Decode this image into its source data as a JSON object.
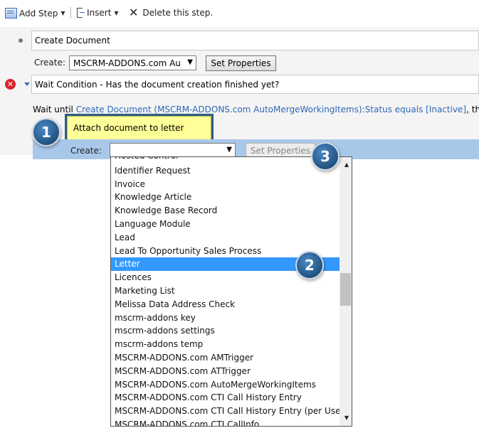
{
  "toolbar": {
    "add_step_label": "Add Step",
    "insert_label": "Insert",
    "delete_label": "Delete this step."
  },
  "step_create_document": {
    "title": "Create Document",
    "create_label": "Create:",
    "entity_value": "MSCRM-ADDONS.com Au",
    "set_properties_label": "Set Properties"
  },
  "wait_condition": {
    "title": "Wait Condition - Has the document creation finished yet?",
    "prefix": "Wait until",
    "condition_link": "Create Document (MSCRM-ADDONS.com AutoMergeWorkingItems):Status equals [Inactive]",
    "suffix": ", then:"
  },
  "inner_step": {
    "title": "Attach document to letter",
    "create_label": "Create:",
    "entity_value": "",
    "set_properties_label": "Set Properties"
  },
  "dropdown": {
    "partial_top": "Hosted Control",
    "items": [
      "Identifier Request",
      "Invoice",
      "Knowledge Article",
      "Knowledge Base Record",
      "Language Module",
      "Lead",
      "Lead To Opportunity Sales Process",
      "Letter",
      "Licences",
      "Marketing List",
      "Melissa Data Address Check",
      "mscrm-addons key",
      "mscrm-addons settings",
      "mscrm-addons temp",
      "MSCRM-ADDONS.com AMTrigger",
      "MSCRM-ADDONS.com ATTrigger",
      "MSCRM-ADDONS.com AutoMergeWorkingItems",
      "MSCRM-ADDONS.com CTI Call History Entry",
      "MSCRM-ADDONS.com CTI Call History Entry (per User)",
      "MSCRM-ADDONS.com CTI CallInfo"
    ],
    "selected": "Letter"
  },
  "callouts": {
    "one": "1",
    "two": "2",
    "three": "3"
  },
  "colors": {
    "link": "#2e68b7",
    "selection": "#3399ff",
    "highlight": "#ffff99",
    "badge": "#21527f",
    "error": "#d8222b"
  }
}
